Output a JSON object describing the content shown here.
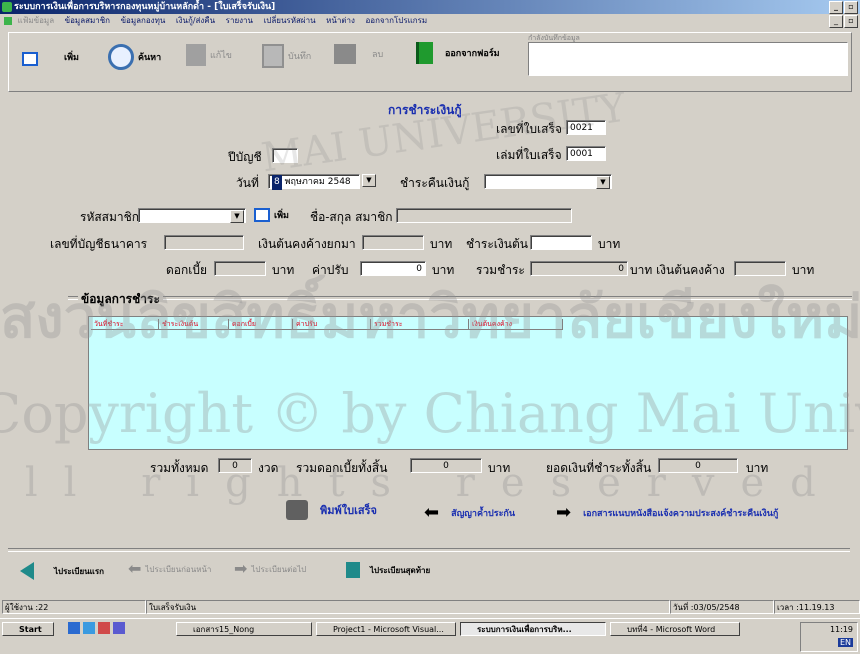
{
  "window": {
    "title": "ระบบการเงินเพื่อการบริหารกองทุนหมู่บ้านหลักด้ำ - [ใบเสร็จรับเงิน]",
    "buttons": [
      "_",
      "▫",
      "×"
    ]
  },
  "menu": {
    "items": [
      "แฟ้มข้อมูล",
      "ข้อมูลสมาชิก",
      "ข้อมูลกองทุน",
      "เงินกู้/ส่งคืน",
      "รายงาน",
      "เปลี่ยนรหัสผ่าน",
      "หน้าต่าง",
      "ออกจากโปรแกรม"
    ]
  },
  "toolbar": {
    "add": "เพิ่ม",
    "search": "ค้นหา",
    "edit": "แก้ไข",
    "save": "บันทึก",
    "delete": "ลบ",
    "exit": "ออกจากฟอร์ม",
    "status_caption": "กำลังบันทึกข้อมูล"
  },
  "form": {
    "heading": "การชำระเงินกู้",
    "receipt_no_label": "เลขที่ใบเสร็จ",
    "receipt_no": "0021",
    "book_no_label": "เล่มที่ใบเสร็จ",
    "book_no": "0001",
    "fiscal_year_label": "ปีบัญชี",
    "fiscal_year": "",
    "date_label": "วันที่",
    "date_day": "8",
    "date_month": "พฤษภาคม",
    "date_year": "2548",
    "repay_label": "ชำระคืนเงินกู้",
    "repay_value": "",
    "member_code_label": "รหัสสมาชิก",
    "member_code": "",
    "member_add": "เพิ่ม",
    "member_name_label": "ชื่อ-สกุล สมาชิก",
    "member_name": "",
    "bank_account_label": "เลขที่บัญชีธนาคาร",
    "bank_account": "",
    "principal_brought_label": "เงินต้นคงค้างยกมา",
    "principal_brought": "",
    "baht": "บาท",
    "principal_pay_label": "ชำระเงินต้น",
    "principal_pay": "",
    "interest_label": "ดอกเบี้ย",
    "interest": "",
    "fine_label": "ค่าปรับ",
    "fine": "0",
    "total_label": "รวมชำระ",
    "total": "0",
    "principal_remaining_label": "บาท เงินต้นคงค้าง",
    "principal_remaining": ""
  },
  "payments": {
    "section_label": "ข้อมูลการชำระ",
    "columns": [
      "วันที่ชำระ",
      "ชำระเงินต้น",
      "ดอกเบี้ย",
      "ค่าปรับ",
      "รวมชำระ",
      "เงินต้นคงค้าง"
    ]
  },
  "summary": {
    "total_count_label": "รวมทั้งหมด",
    "total_count": "0",
    "installment_unit": "งวด",
    "total_interest_label": "รวมดอกเบี้ยทั้งสิ้น",
    "total_interest": "0",
    "baht": "บาท",
    "total_paid_label": "ยอดเงินที่ชำระทั้งสิ้น",
    "total_paid": "0"
  },
  "actions": {
    "print_receipt": "พิมพ์ใบเสร็จ",
    "guarantee": "สัญญาค้ำประกัน",
    "notice_doc": "เอกสารแนบหนังสือแจ้งความประสงค์ชำระคืนเงินกู้"
  },
  "navigation": {
    "first": "ไประเบียนแรก",
    "prev": "ไประเบียนก่อนหน้า",
    "next": "ไประเบียนต่อไป",
    "last": "ไประเบียนสุดท้าย"
  },
  "statusbar": {
    "user": "ผู้ใช้งาน :22",
    "form": "ใบเสร็จรับเงิน",
    "date": "วันที่ :03/05/2548",
    "time": "เวลา :11.19.13"
  },
  "taskbar": {
    "start": "Start",
    "tasks": [
      "เอกสาร15_Nong",
      "Project1 - Microsoft Visual...",
      "ระบบการเงินเพื่อการบริห...",
      "บทที่4 - Microsoft Word"
    ],
    "clock": "11:19",
    "tray": "EN"
  },
  "watermark": {
    "line1": "สงวนลิขสิทธิ์มหาวิทยาลัยเชียงใหม่",
    "line2": "Copyright © by Chiang Mai University",
    "line3": "All rights reserved",
    "arc": "MAI UNIVERSITY"
  },
  "colors": {
    "title_start": "#0a246a",
    "grid_bg": "#c8ffff",
    "header_text": "#e0001a",
    "heading": "#1a2fb0"
  }
}
